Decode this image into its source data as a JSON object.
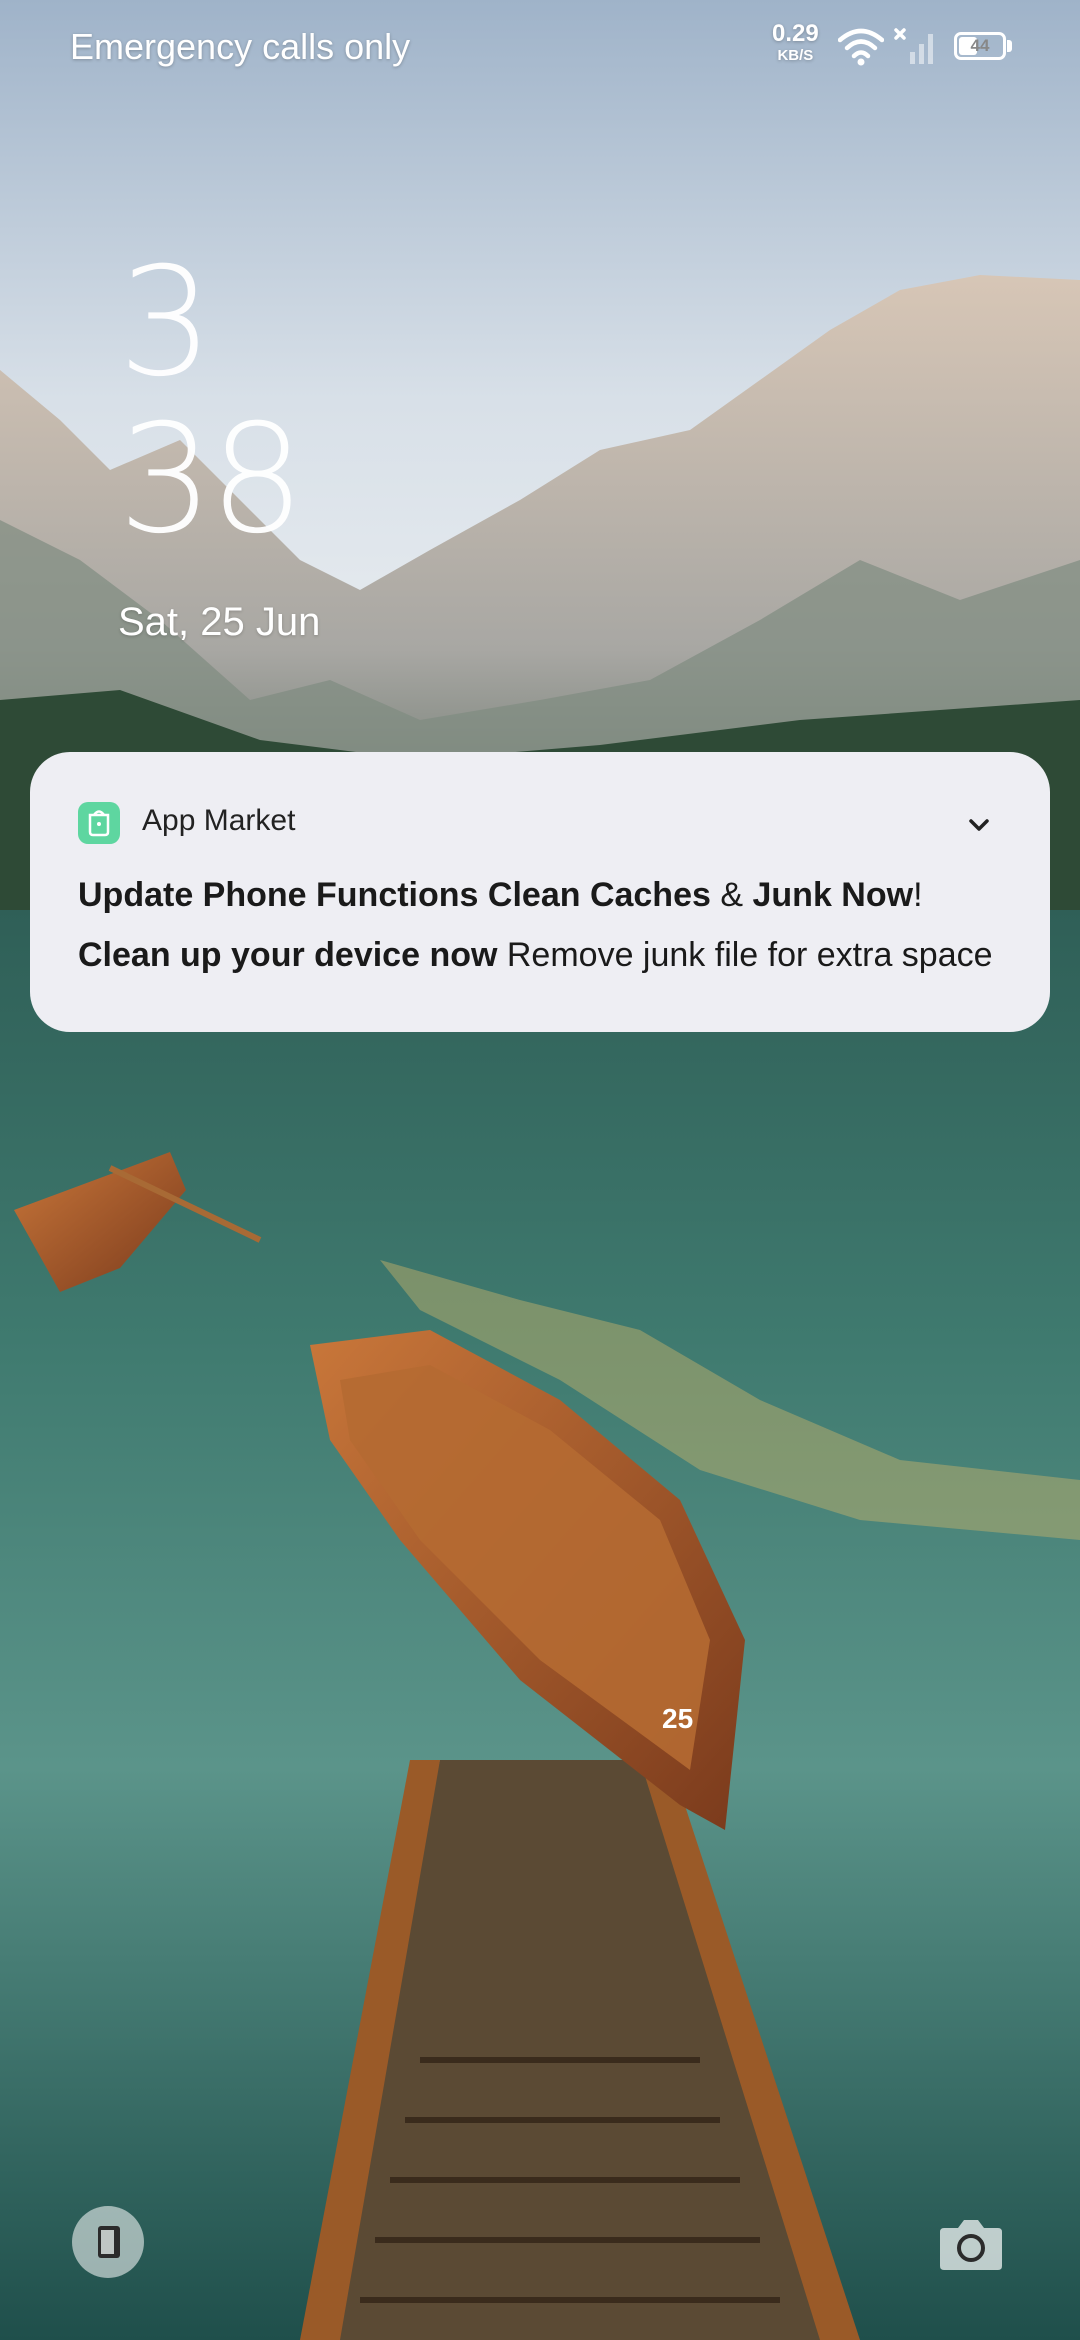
{
  "status_bar": {
    "carrier": "Emergency calls only",
    "net_speed_value": "0.29",
    "net_speed_unit": "KB/S",
    "battery_level": "44",
    "icons": [
      "wifi-icon",
      "no-sim-icon",
      "battery-icon"
    ]
  },
  "lock_screen": {
    "clock_hour": "3",
    "clock_minute": "38",
    "date": "Sat, 25 Jun"
  },
  "notification": {
    "app_name": "App Market",
    "app_icon_color": "#5ed6a0",
    "title_part1": "Update Phone Functions",
    "title_part2": "Clean Caches",
    "title_part3": "&",
    "title_part4": "Junk Now",
    "title_part5": "!",
    "body_bold": "Clean up your device now",
    "body_text": "Remove junk file for extra space"
  },
  "shortcuts": {
    "left": "phone-icon",
    "right": "camera-icon"
  }
}
